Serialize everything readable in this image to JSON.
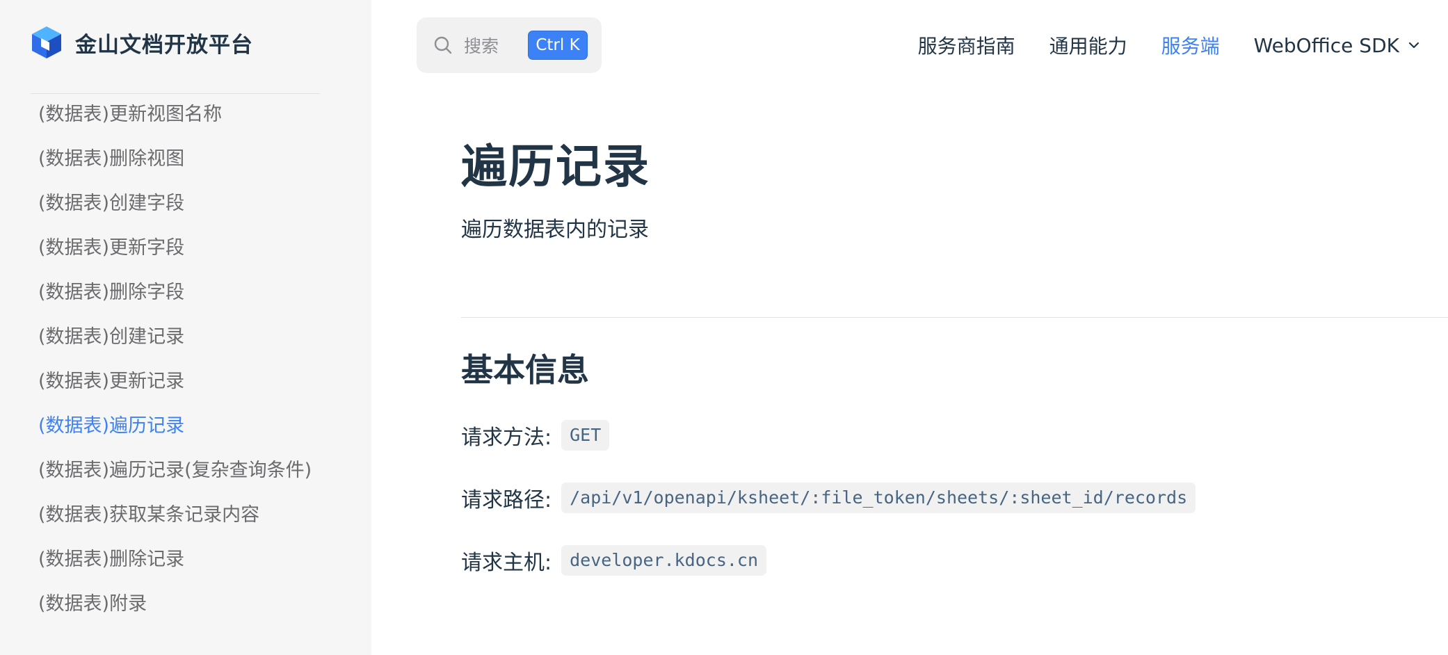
{
  "brand": {
    "title": "金山文档开放平台"
  },
  "search": {
    "label": "搜索",
    "shortcut": "Ctrl K"
  },
  "nav": {
    "items": [
      {
        "label": "服务商指南"
      },
      {
        "label": "通用能力"
      },
      {
        "label": "服务端"
      },
      {
        "label": "WebOffice SDK"
      }
    ],
    "active": "服务端",
    "accent_color": "#3c82f6"
  },
  "sidebar": {
    "items": [
      {
        "label": "(数据表)更新视图名称"
      },
      {
        "label": "(数据表)删除视图"
      },
      {
        "label": "(数据表)创建字段"
      },
      {
        "label": "(数据表)更新字段"
      },
      {
        "label": "(数据表)删除字段"
      },
      {
        "label": "(数据表)创建记录"
      },
      {
        "label": "(数据表)更新记录"
      },
      {
        "label": "(数据表)遍历记录"
      },
      {
        "label": "(数据表)遍历记录(复杂查询条件)"
      },
      {
        "label": "(数据表)获取某条记录内容"
      },
      {
        "label": "(数据表)删除记录"
      },
      {
        "label": "(数据表)附录"
      }
    ],
    "active": "(数据表)遍历记录"
  },
  "main": {
    "title": "遍历记录",
    "description": "遍历数据表内的记录",
    "section_title": "基本信息",
    "info": {
      "method_label": "请求方法:",
      "method_value": "GET",
      "path_label": "请求路径:",
      "path_value": "/api/v1/openapi/ksheet/:file_token/sheets/:sheet_id/records",
      "host_label": "请求主机:",
      "host_value": "developer.kdocs.cn"
    }
  },
  "icons": {
    "logo": "kdocs-cube-logo",
    "search": "search-icon",
    "dropdown": "chevron-down-icon"
  }
}
